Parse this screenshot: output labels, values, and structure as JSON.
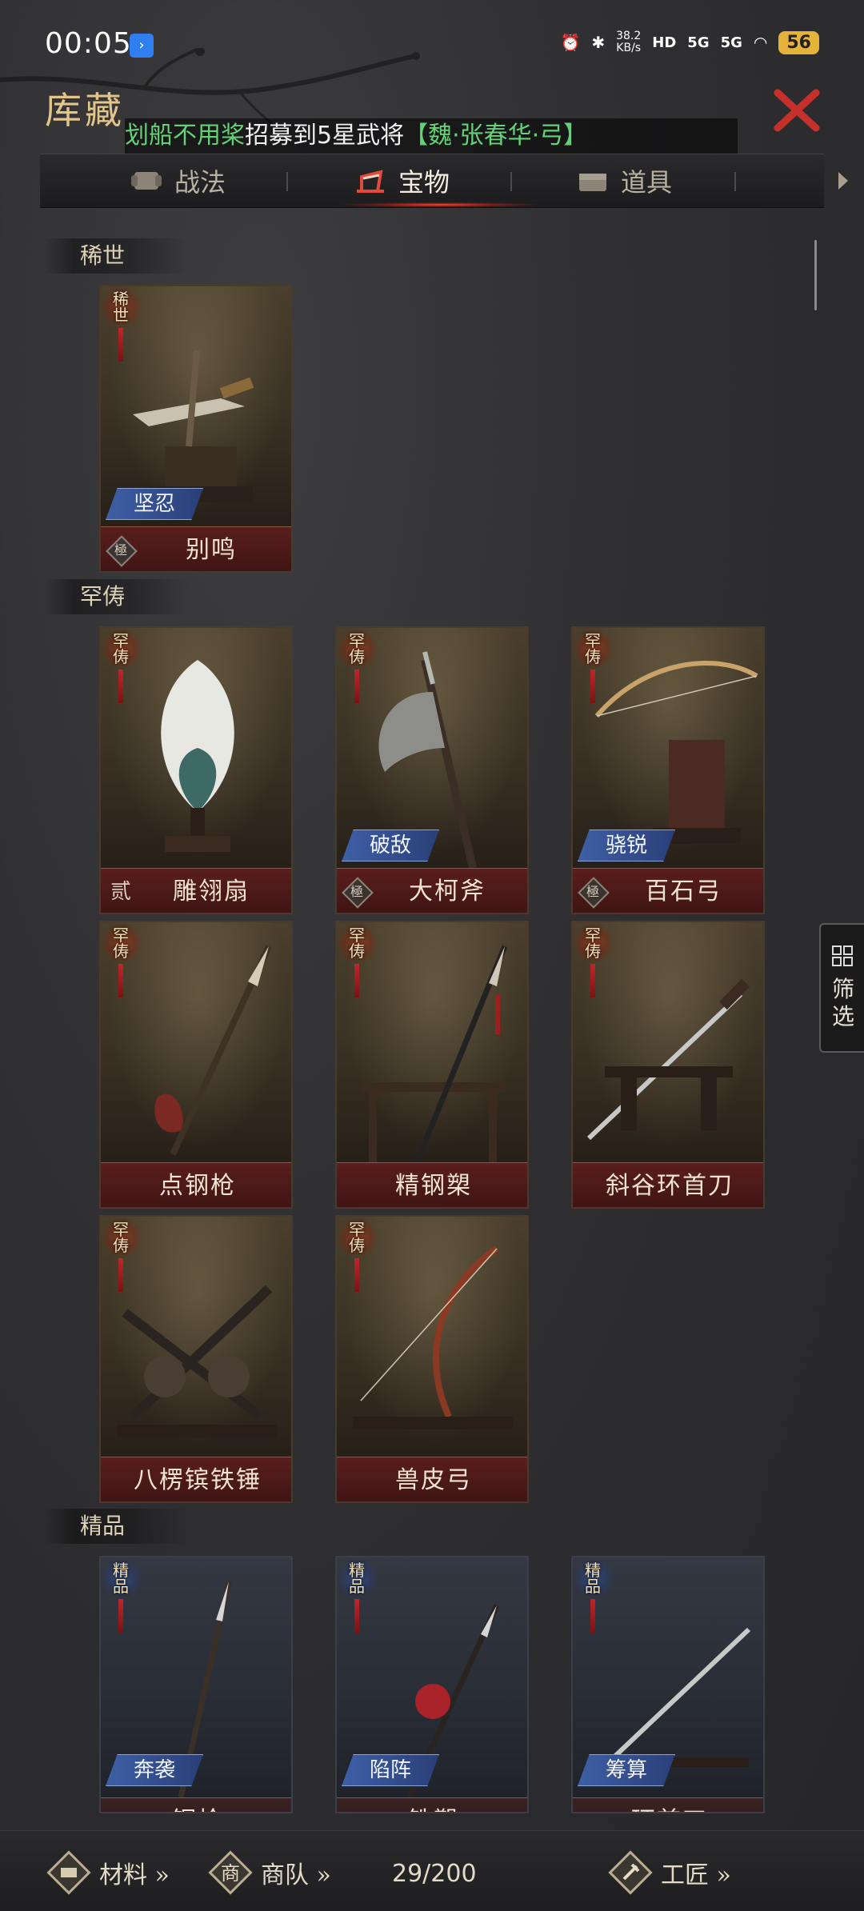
{
  "status": {
    "time": "00:05",
    "speed": "38.2",
    "speed_unit": "KB/s",
    "hd": "HD",
    "net1": "5G",
    "net2": "5G",
    "battery": "56"
  },
  "header": {
    "title": "库藏",
    "ticker_prefix": "划船不用桨",
    "ticker_mid": "招募到5星武将",
    "ticker_hero": "【魏·张春华·弓】"
  },
  "tabs": [
    {
      "label": "战法",
      "icon": "scroll-icon"
    },
    {
      "label": "宝物",
      "icon": "treasure-icon"
    },
    {
      "label": "道具",
      "icon": "chest-icon"
    }
  ],
  "sections": [
    {
      "label": "稀世",
      "items": [
        {
          "tag": "稀世",
          "trait": "坚忍",
          "grade": "極",
          "name": "别鸣",
          "art": "dagger"
        }
      ]
    },
    {
      "label": "罕俦",
      "items": [
        {
          "tag": "罕俦",
          "trait": "",
          "grade_text": "贰",
          "name": "雕翎扇",
          "art": "fan"
        },
        {
          "tag": "罕俦",
          "trait": "破敌",
          "grade": "極",
          "name": "大柯斧",
          "art": "axe"
        },
        {
          "tag": "罕俦",
          "trait": "骁锐",
          "grade": "極",
          "name": "百石弓",
          "art": "bow"
        },
        {
          "tag": "罕俦",
          "trait": "",
          "name": "点钢枪",
          "art": "spear"
        },
        {
          "tag": "罕俦",
          "trait": "",
          "name": "精钢槊",
          "art": "lance"
        },
        {
          "tag": "罕俦",
          "trait": "",
          "name": "斜谷环首刀",
          "art": "sword"
        },
        {
          "tag": "罕俦",
          "trait": "",
          "name": "八楞镔铁锤",
          "art": "hammers"
        },
        {
          "tag": "罕俦",
          "trait": "",
          "name": "兽皮弓",
          "art": "bow2"
        }
      ]
    },
    {
      "label": "精品",
      "items": [
        {
          "tag": "精品",
          "trait": "奔袭",
          "name": "钢枪",
          "art": "spear"
        },
        {
          "tag": "精品",
          "trait": "陷阵",
          "name": "铁槊",
          "art": "lance"
        },
        {
          "tag": "精品",
          "trait": "筹算",
          "name": "环首刀",
          "art": "sword"
        }
      ]
    }
  ],
  "filter": {
    "label": "筛选"
  },
  "bottom": {
    "materials": "材料 »",
    "caravan": "商队 »",
    "count": "29/200",
    "craftsman": "工匠 »"
  },
  "colors": {
    "gold": "#e3c48a",
    "tab_active_glow": "#ff4a2a",
    "ticker_green": "#63d276",
    "trait_blue": "#3e5fa6"
  }
}
